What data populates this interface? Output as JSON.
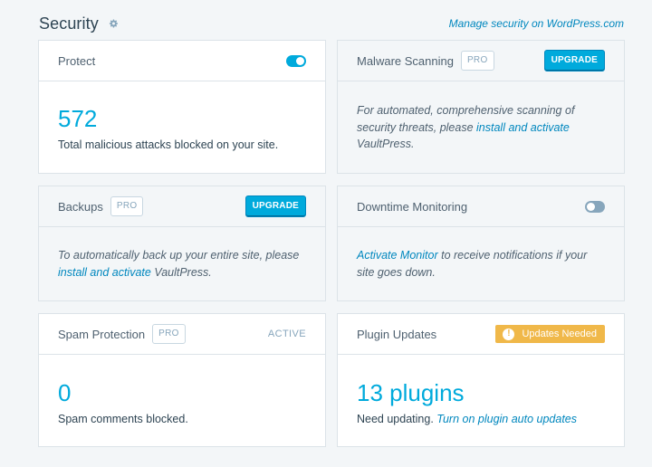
{
  "header": {
    "title": "Security",
    "gear_icon": "gear-icon",
    "manage_link": "Manage security on WordPress.com"
  },
  "colors": {
    "accent": "#00aadc",
    "link": "#0087be",
    "warning": "#f0b849",
    "muted": "#87a6bc"
  },
  "cards": {
    "protect": {
      "title": "Protect",
      "toggle_on": true,
      "stat": "572",
      "description": "Total malicious attacks blocked on your site."
    },
    "malware": {
      "title": "Malware Scanning",
      "badge": "PRO",
      "button": "UPGRADE",
      "text_before": "For automated, comprehensive scanning of security threats, please ",
      "link": "install and activate",
      "text_after": " VaultPress."
    },
    "backups": {
      "title": "Backups",
      "badge": "PRO",
      "button": "UPGRADE",
      "text_before": "To automatically back up your entire site, please ",
      "link": "install and activate",
      "text_after": " VaultPress."
    },
    "downtime": {
      "title": "Downtime Monitoring",
      "toggle_on": false,
      "link": "Activate Monitor",
      "text_after": " to receive notifications if your site goes down."
    },
    "spam": {
      "title": "Spam Protection",
      "badge": "PRO",
      "status": "ACTIVE",
      "stat": "0",
      "description": "Spam comments blocked."
    },
    "plugins": {
      "title": "Plugin Updates",
      "warning_badge": "Updates Needed",
      "warning_icon": "alert-icon",
      "stat": "13 plugins",
      "text_before": "Need updating. ",
      "link": "Turn on plugin auto updates"
    }
  }
}
